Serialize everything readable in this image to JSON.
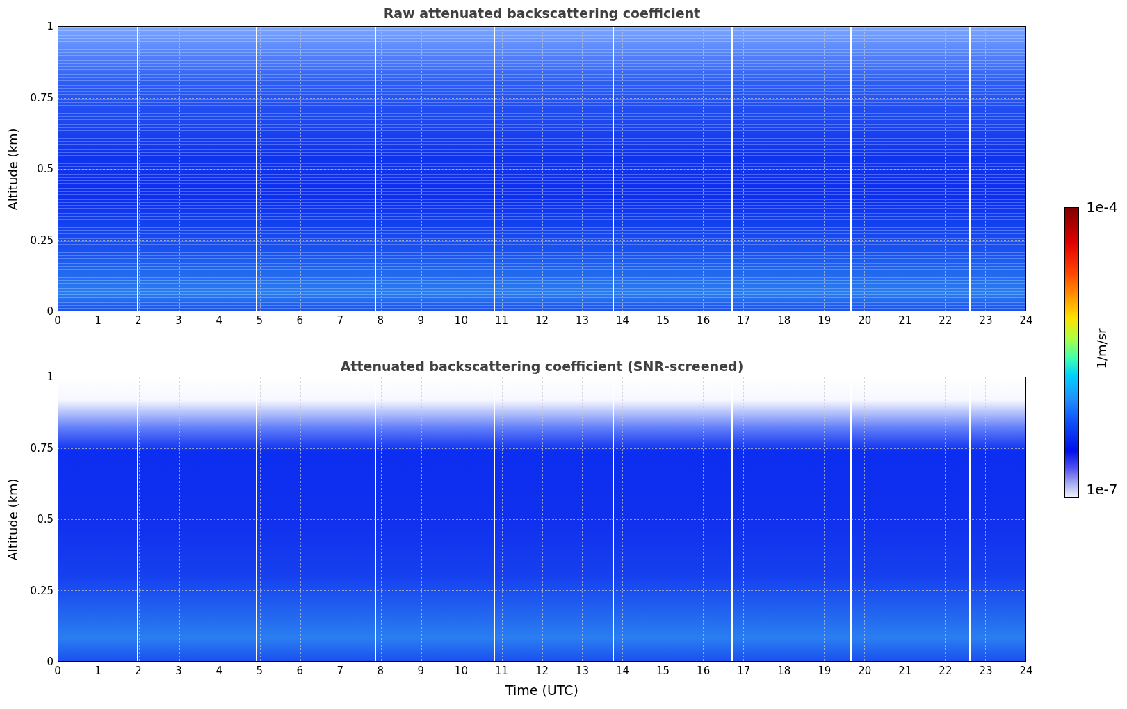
{
  "figure": {
    "panels": [
      {
        "kind": "raw",
        "title": "Raw attenuated backscattering coefficient",
        "ylabel": "Altitude (km)",
        "yticks": [
          "1",
          "0.75",
          "0.5",
          "0.25",
          "0"
        ],
        "xticks": [
          "0",
          "1",
          "2",
          "3",
          "4",
          "5",
          "6",
          "7",
          "8",
          "9",
          "10",
          "11",
          "12",
          "13",
          "14",
          "15",
          "16",
          "17",
          "18",
          "19",
          "20",
          "21",
          "22",
          "23",
          "24"
        ]
      },
      {
        "kind": "screened",
        "title": "Attenuated backscattering coefficient (SNR-screened)",
        "ylabel": "Altitude (km)",
        "yticks": [
          "1",
          "0.75",
          "0.5",
          "0.25",
          "0"
        ],
        "xticks": [
          "0",
          "1",
          "2",
          "3",
          "4",
          "5",
          "6",
          "7",
          "8",
          "9",
          "10",
          "11",
          "12",
          "13",
          "14",
          "15",
          "16",
          "17",
          "18",
          "19",
          "20",
          "21",
          "22",
          "23",
          "24"
        ]
      }
    ],
    "xlabel": "Time (UTC)",
    "colorbar": {
      "max": "1e-4",
      "min": "1e-7",
      "label": "1/m/sr"
    }
  }
}
